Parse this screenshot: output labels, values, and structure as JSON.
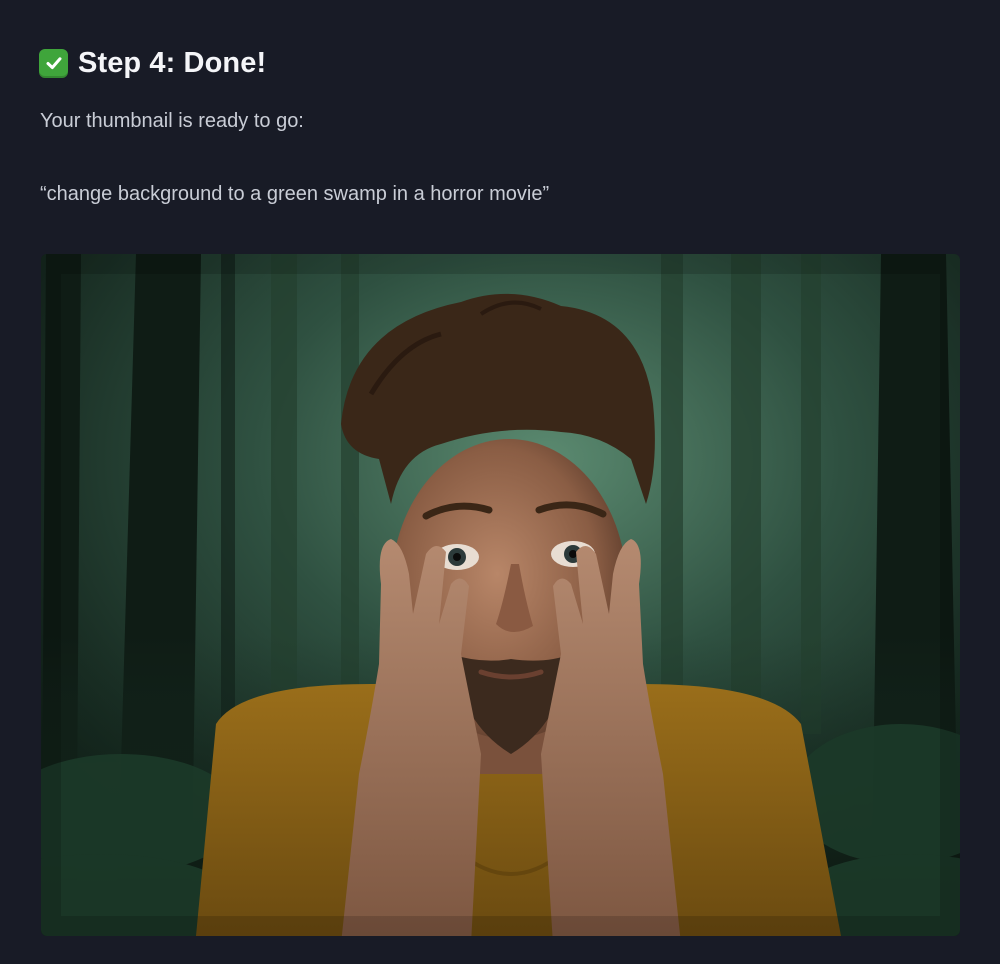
{
  "header": {
    "check_icon": "white-check-mark-icon",
    "title": "Step 4: Done!"
  },
  "body": {
    "intro": "Your thumbnail is ready to go:",
    "prompt": "“change background to a green swamp in a horror movie”"
  },
  "thumbnail": {
    "description_icon": "photo",
    "colors": {
      "forest_dark": "#0e1a14",
      "forest_mid": "#2c4a3a",
      "fog": "#5f8a72",
      "shirt": "#8a6216",
      "skin": "#a0745a",
      "hair": "#3a2718"
    }
  }
}
